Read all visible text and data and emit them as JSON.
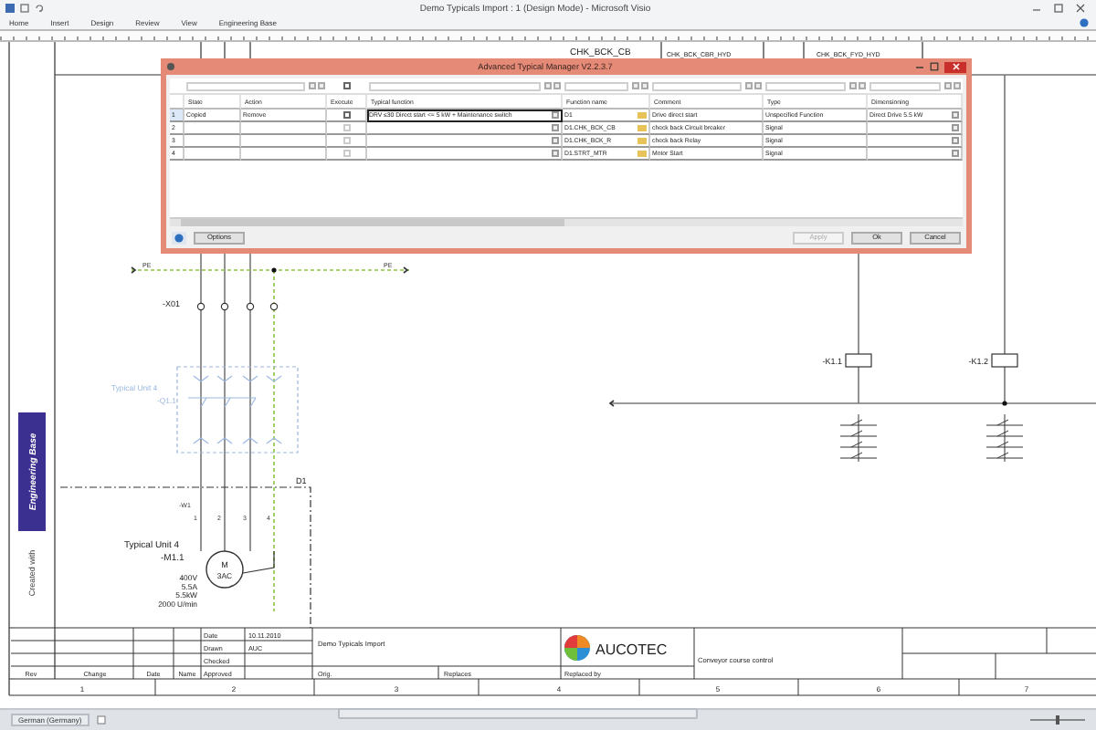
{
  "window": {
    "title": "Demo Typicals Import : 1 (Design Mode) - Microsoft Visio"
  },
  "ribbon_tabs": [
    {
      "label": "Home",
      "selected": false
    },
    {
      "label": "Insert",
      "selected": false
    },
    {
      "label": "Design",
      "selected": false
    },
    {
      "label": "Review",
      "selected": false
    },
    {
      "label": "View",
      "selected": false
    },
    {
      "label": "Engineering Base",
      "selected": false
    }
  ],
  "schematic": {
    "header_labels": [
      "CHK_BCK_CB",
      "CHK_BCK_CBR_HYD",
      "CHK_BCK_FYD_HYD"
    ],
    "pe_labels": [
      "PE",
      "PE"
    ],
    "terminal_strip": "-X01",
    "ghost_unit": [
      "Typical Unit 4",
      "-Q1.1"
    ],
    "device": "D1",
    "cable": "-W1",
    "wire_numbers": [
      "1",
      "2",
      "3",
      "4"
    ],
    "motor_unit": [
      "Typical Unit 4",
      "-M1.1"
    ],
    "motor_symbol": [
      "M",
      "3AC"
    ],
    "motor_specs": [
      "400V",
      "5.5A",
      "5.5kW",
      "2000 U/min"
    ],
    "coils": [
      {
        "label": "-K1.1"
      },
      {
        "label": "-K1.2"
      }
    ],
    "badge": "Engineering Base",
    "created_with": "Created with"
  },
  "dialog": {
    "title": "Advanced Typical Manager V2.2.3.7",
    "filter_execute": {
      "checked": false
    },
    "columns": [
      "State",
      "Action",
      "Execute",
      "Typical function",
      "Function name",
      "Comment",
      "Type",
      "Dimensioning"
    ],
    "rows": [
      {
        "number": "1",
        "state": "Copied",
        "action": "Remove",
        "execute": {
          "checked": false,
          "disabled": false
        },
        "typical_function": "DRV ≤30 Direct start <= 5 kW + Maintenance switch",
        "function_name": "D1",
        "comment": "Drive direct start",
        "type": "Unspecified Function",
        "dimensioning": "Direct Drive 5.5 kW",
        "selected": true
      },
      {
        "number": "2",
        "execute": {
          "checked": false,
          "disabled": true
        },
        "function_name": "D1.CHK_BCK_CB",
        "comment": "check back Circuit breaker",
        "type": "Signal",
        "selected": false
      },
      {
        "number": "3",
        "execute": {
          "checked": false,
          "disabled": true
        },
        "function_name": "D1.CHK_BCK_R",
        "comment": "check back Relay",
        "type": "Signal",
        "selected": false
      },
      {
        "number": "4",
        "execute": {
          "checked": false,
          "disabled": true
        },
        "function_name": "D1.STRT_MTR",
        "comment": "Motor Start",
        "type": "Signal",
        "selected": false
      }
    ],
    "buttons": [
      {
        "label": "Options",
        "disabled": false
      },
      {
        "label": "Apply",
        "disabled": true
      },
      {
        "label": "Ok",
        "disabled": false
      },
      {
        "label": "Cancel",
        "disabled": false
      }
    ]
  },
  "title_block": {
    "fields": [
      "Date",
      "Drawn",
      "Checked",
      "Approved"
    ],
    "values": [
      "10.11.2010",
      "AUC"
    ],
    "revision_headers": [
      "Rev",
      "Change",
      "Date",
      "Name"
    ],
    "project": "Demo Typicals Import",
    "orig": "Orig.",
    "replaces": "Replaces",
    "replaced_by": "Replaced by",
    "company": "AUCOTEC",
    "drawing_title": "Conveyor course control"
  },
  "column_numbers": [
    "1",
    "2",
    "3",
    "4",
    "5",
    "6",
    "7"
  ],
  "status_bar": {
    "language": "German (Germany)",
    "zoom": {
      "level": 0.5
    }
  }
}
